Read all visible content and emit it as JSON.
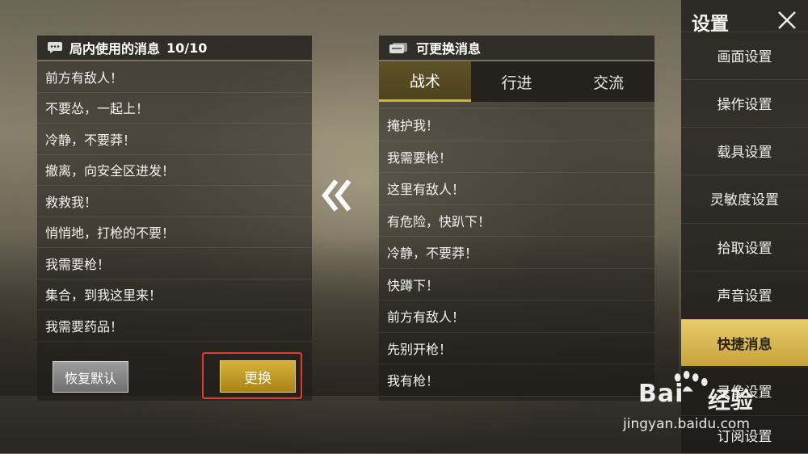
{
  "left_panel": {
    "title": "局内使用的消息",
    "count": "10/10",
    "icon": "chat-bubble-icon",
    "messages": [
      "前方有敌人！",
      "不要怂，一起上！",
      "冷静，不要莽！",
      "撤离，向安全区进发！",
      "救救我！",
      "悄悄地，打枪的不要！",
      "我需要枪！",
      "集合，到我这里来！",
      "我需要药品！"
    ],
    "restore_label": "恢复默认",
    "change_label": "更换"
  },
  "right_panel": {
    "title": "可更换消息",
    "icon": "message-swap-icon",
    "tabs": [
      "战术",
      "行进",
      "交流"
    ],
    "active_tab": "战术",
    "messages": [
      "掩护我！",
      "我需要枪！",
      "这里有敌人！",
      "有危险，快趴下！",
      "冷静，不要莽！",
      "快蹲下！",
      "前方有敌人！",
      "先别开枪！",
      "我有枪！"
    ]
  },
  "sidebar": {
    "title": "设置",
    "items": [
      "画面设置",
      "操作设置",
      "载具设置",
      "灵敏度设置",
      "拾取设置",
      "声音设置",
      "快捷消息",
      "录像设置",
      "订阅设置"
    ],
    "active": "快捷消息"
  },
  "watermark": {
    "brand": "Bai",
    "brand_cn": "经验",
    "url": "jingyan.baidu.com"
  },
  "colors": {
    "accent": "#d7b23a",
    "highlight": "#e53a2e"
  }
}
